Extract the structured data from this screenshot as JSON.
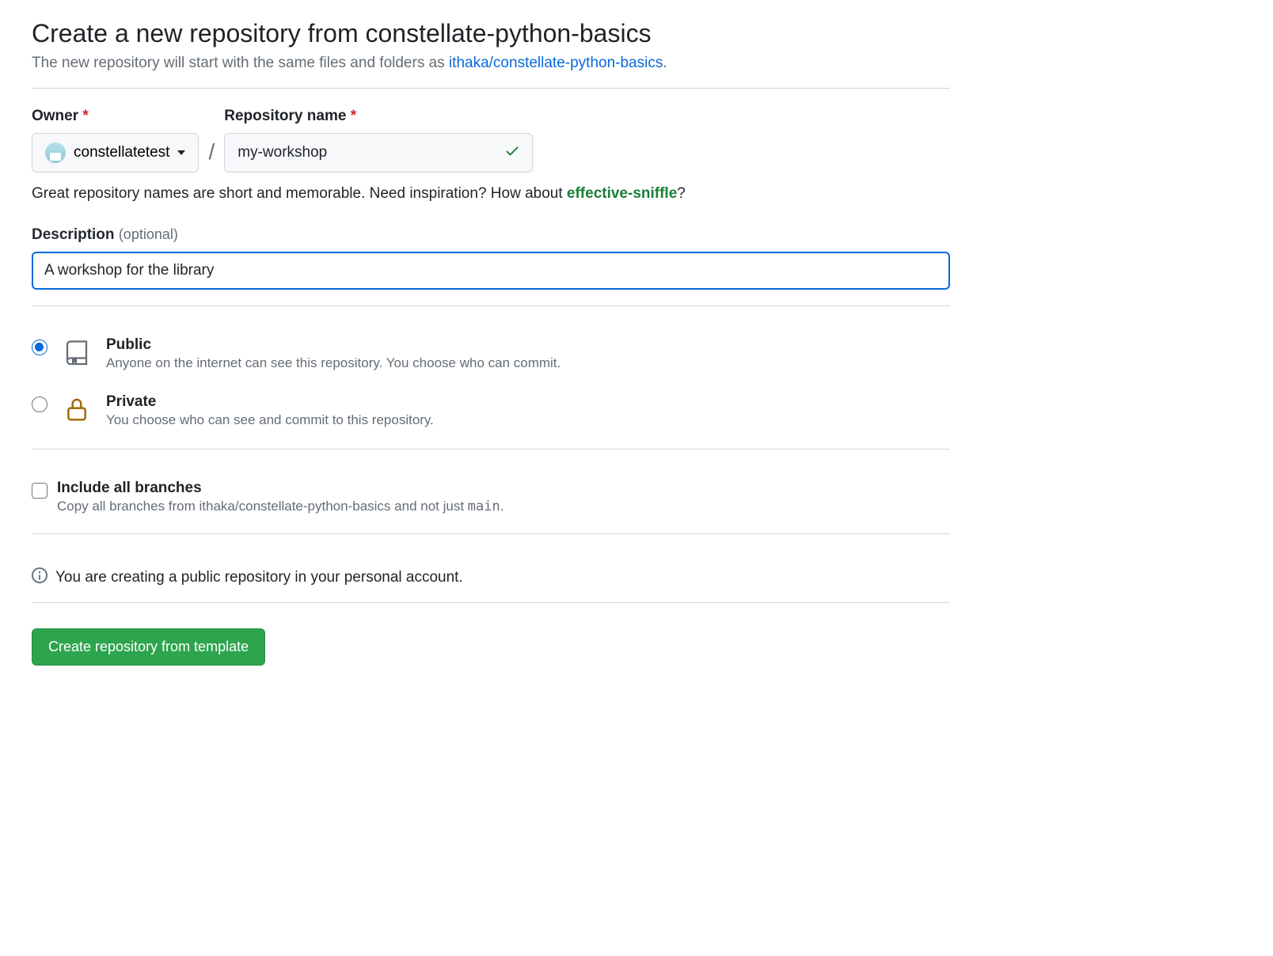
{
  "header": {
    "title": "Create a new repository from constellate-python-basics",
    "subtitle_prefix": "The new repository will start with the same files and folders as ",
    "subtitle_link": "ithaka/constellate-python-basics",
    "subtitle_suffix": "."
  },
  "owner": {
    "label": "Owner",
    "value": "constellatetest"
  },
  "repo_name": {
    "label": "Repository name",
    "value": "my-workshop"
  },
  "hint": {
    "text_before": "Great repository names are short and memorable. Need inspiration? How about ",
    "suggestion": "effective-sniffle",
    "text_after": "?"
  },
  "description": {
    "label": "Description",
    "optional": "(optional)",
    "value": "A workshop for the library"
  },
  "visibility": {
    "public": {
      "title": "Public",
      "desc": "Anyone on the internet can see this repository. You choose who can commit."
    },
    "private": {
      "title": "Private",
      "desc": "You choose who can see and commit to this repository."
    }
  },
  "include_branches": {
    "title": "Include all branches",
    "desc_before": "Copy all branches from ithaka/constellate-python-basics and not just ",
    "main": "main",
    "desc_after": "."
  },
  "info_text": "You are creating a public repository in your personal account.",
  "submit_label": "Create repository from template"
}
